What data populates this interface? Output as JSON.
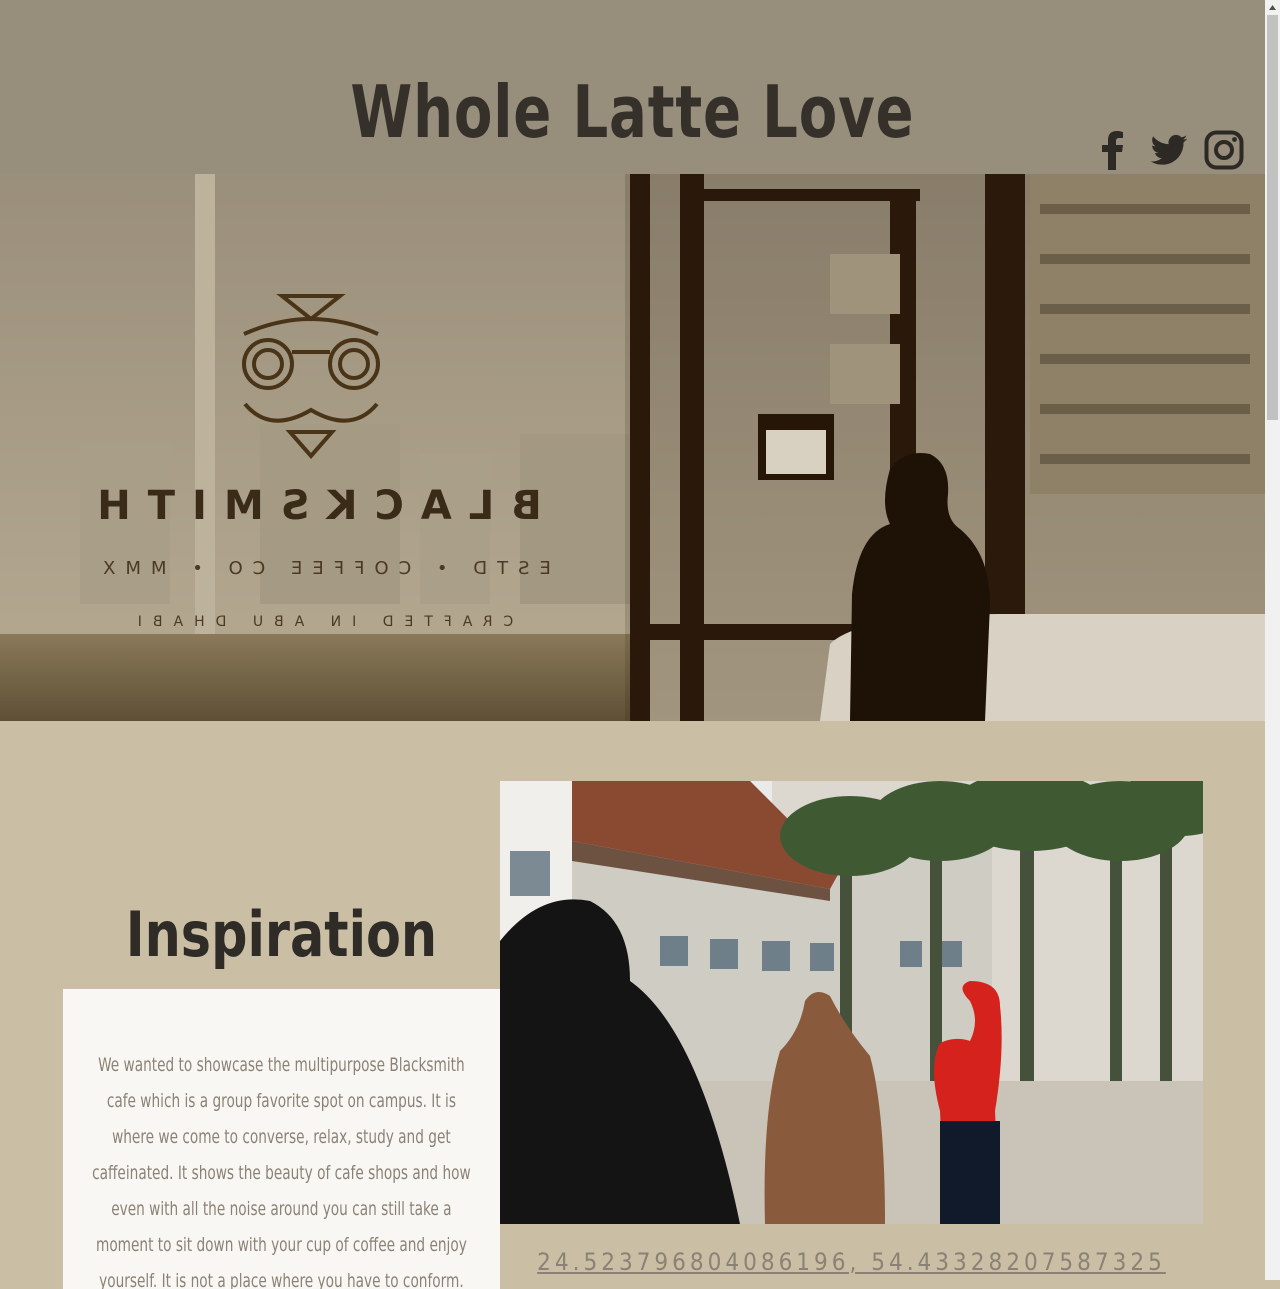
{
  "header": {
    "title": "Whole Latte Love",
    "social": [
      {
        "name": "facebook-icon"
      },
      {
        "name": "twitter-icon"
      },
      {
        "name": "instagram-icon"
      }
    ]
  },
  "hero": {
    "sign_text": "BLACKSMITH",
    "sign_line2": "ESTD • COFFEE CO • MMX",
    "sign_line3": "CRAFTED IN ABU DHABI"
  },
  "inspiration": {
    "heading": "Inspiration",
    "body": "We wanted to showcase the multipurpose Blacksmith cafe which is a group favorite spot on campus. It is where we come to converse, relax, study and get caffeinated. It shows the beauty of cafe shops and how even with all the noise around you can still take a moment to sit down with your cup of coffee and enjoy yourself. It is not a place where you have to conform. People that are going through all different type of"
  },
  "location": {
    "coordinates": "24.523796804086196, 54.43328207587325"
  },
  "colors": {
    "header_bg": "#978e7c",
    "page_bg": "#cabea5",
    "title_text": "#35302a",
    "card_bg": "#f8f7f4",
    "muted_text": "#8b8275"
  }
}
